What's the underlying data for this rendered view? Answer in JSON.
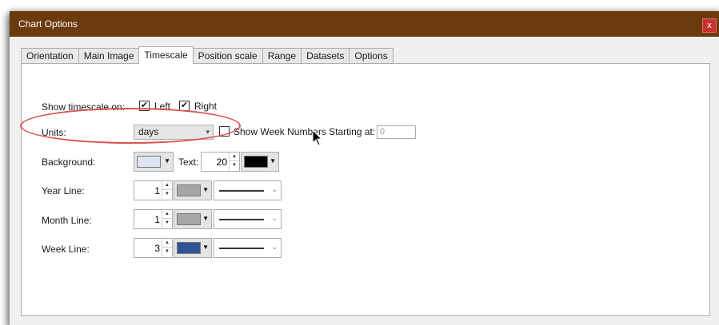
{
  "window": {
    "title": "Chart Options",
    "close_label": "x"
  },
  "tabs": [
    {
      "label": "Orientation",
      "active": false
    },
    {
      "label": "Main Image",
      "active": false
    },
    {
      "label": "Timescale",
      "active": true
    },
    {
      "label": "Position scale",
      "active": false
    },
    {
      "label": "Range",
      "active": false
    },
    {
      "label": "Datasets",
      "active": false
    },
    {
      "label": "Options",
      "active": false
    }
  ],
  "timescale": {
    "show_label": "Show timescale on:",
    "left_label": "Left",
    "left_checked": true,
    "right_label": "Right",
    "right_checked": true,
    "units_label": "Units:",
    "units_value": "days",
    "week_numbers_label": "Show Week Numbers Starting at:",
    "week_numbers_checked": false,
    "week_numbers_value": "0",
    "background_label": "Background:",
    "background_color": "#dde4f2",
    "text_label": "Text:",
    "text_size": "20",
    "text_color": "#000000",
    "year_line_label": "Year Line:",
    "year_line_width": "1",
    "year_line_color": "#a6a6a6",
    "month_line_label": "Month Line:",
    "month_line_width": "1",
    "month_line_color": "#a6a6a6",
    "week_line_label": "Week Line:",
    "week_line_width": "3",
    "week_line_color": "#2f5496"
  },
  "colors": {
    "titlebar": "#6b3a0d",
    "highlight": "#d9534f",
    "close": "#c8322f"
  }
}
